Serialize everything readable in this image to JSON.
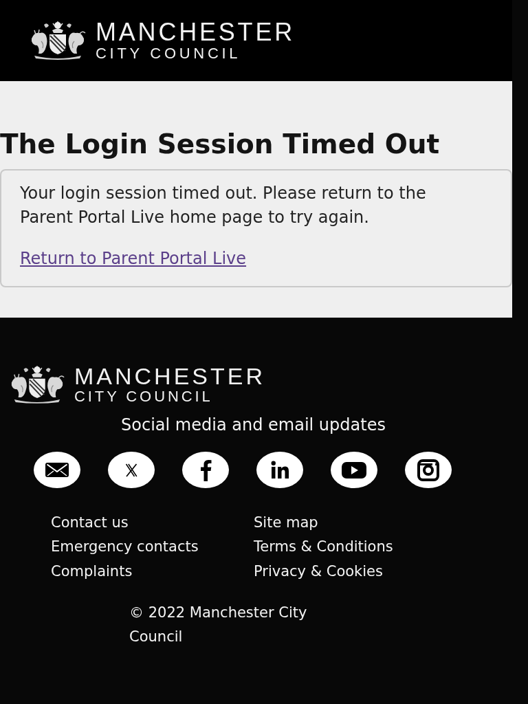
{
  "header": {
    "logo": {
      "title": "MANCHESTER",
      "subtitle": "CITY COUNCIL"
    }
  },
  "content": {
    "heading": "The Login Session Timed Out",
    "message": "Your login session timed out. Please return to the Parent Portal Live home page to try again.",
    "link": "Return to Parent Portal Live"
  },
  "footer": {
    "logo": {
      "title": "MANCHESTER",
      "subtitle": "CITY COUNCIL"
    },
    "social_heading": "Social media and email updates",
    "social_links": [
      {
        "kind": "email"
      },
      {
        "kind": "x"
      },
      {
        "kind": "facebook"
      },
      {
        "kind": "linkedin"
      },
      {
        "kind": "youtube"
      },
      {
        "kind": "instagram"
      }
    ],
    "link_columns": [
      [
        "Contact us",
        "Emergency contacts",
        "Complaints"
      ],
      [
        "Site map",
        "Terms & Conditions",
        "Privacy & Cookies"
      ]
    ],
    "copyright": "© 2022 Manchester City Council"
  }
}
